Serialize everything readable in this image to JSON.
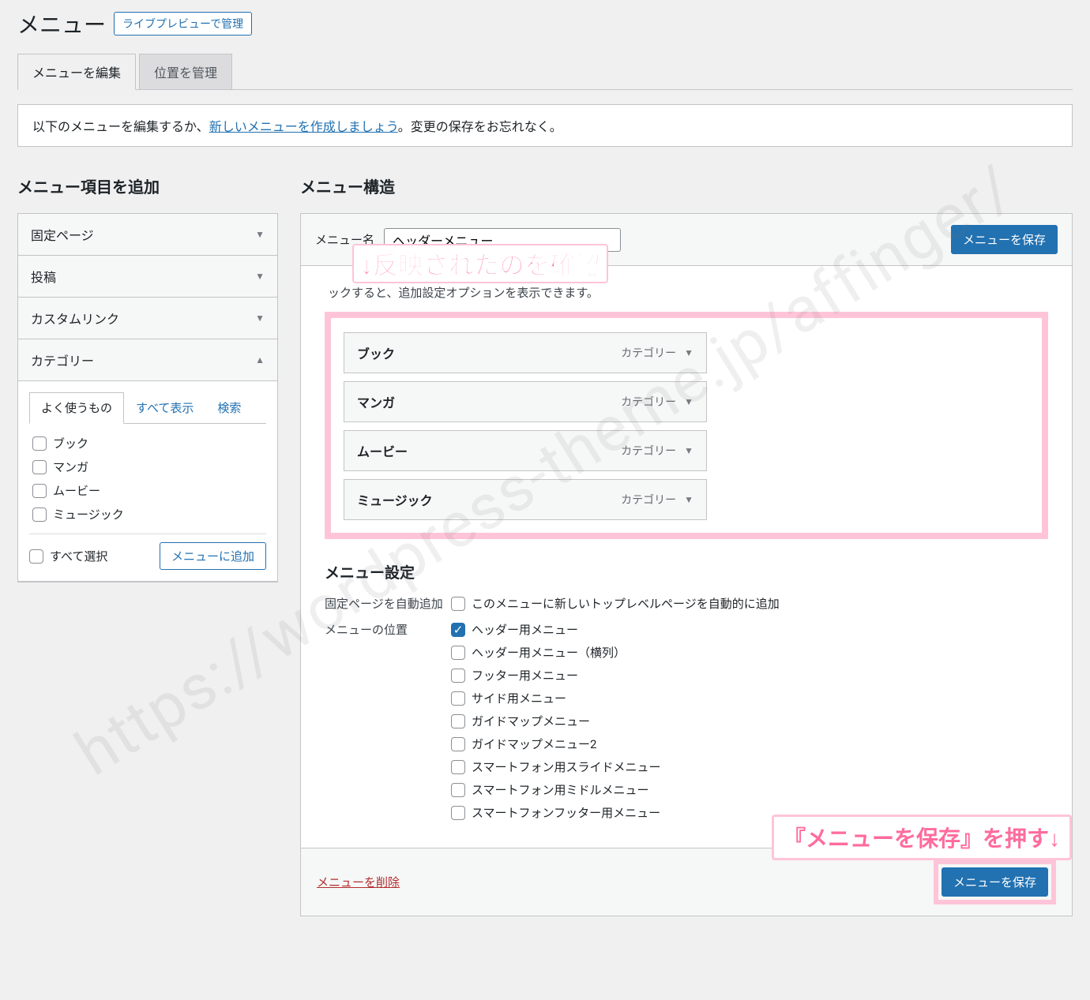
{
  "page": {
    "title": "メニュー",
    "livePreview": "ライブプレビューで管理"
  },
  "tabs": {
    "edit": "メニューを編集",
    "locations": "位置を管理"
  },
  "notice": {
    "prefix": "以下のメニューを編集するか、",
    "link": "新しいメニューを作成しましょう",
    "suffix": "。変更の保存をお忘れなく。"
  },
  "addItems": {
    "title": "メニュー項目を追加",
    "pages": "固定ページ",
    "posts": "投稿",
    "customLinks": "カスタムリンク",
    "categories": "カテゴリー",
    "subtabs": {
      "frequent": "よく使うもの",
      "all": "すべて表示",
      "search": "検索"
    },
    "items": [
      "ブック",
      "マンガ",
      "ムービー",
      "ミュージック"
    ],
    "selectAll": "すべて選択",
    "addToMenu": "メニューに追加"
  },
  "structure": {
    "title": "メニュー構造",
    "menuNameLabel": "メニュー名",
    "menuNameValue": "ヘッダーメニュー",
    "saveButton": "メニューを保存",
    "hint": "ックすると、追加設定オプションを表示できます。",
    "annotation1": "↓反映されたのを確認",
    "items": [
      {
        "title": "ブック",
        "type": "カテゴリー"
      },
      {
        "title": "マンガ",
        "type": "カテゴリー"
      },
      {
        "title": "ムービー",
        "type": "カテゴリー"
      },
      {
        "title": "ミュージック",
        "type": "カテゴリー"
      }
    ]
  },
  "settings": {
    "title": "メニュー設定",
    "autoAddLabel": "固定ページを自動追加",
    "autoAddText": "このメニューに新しいトップレベルページを自動的に追加",
    "locationLabel": "メニューの位置",
    "locations": [
      {
        "label": "ヘッダー用メニュー",
        "checked": true
      },
      {
        "label": "ヘッダー用メニュー（横列）",
        "checked": false
      },
      {
        "label": "フッター用メニュー",
        "checked": false
      },
      {
        "label": "サイド用メニュー",
        "checked": false
      },
      {
        "label": "ガイドマップメニュー",
        "checked": false
      },
      {
        "label": "ガイドマップメニュー2",
        "checked": false
      },
      {
        "label": "スマートフォン用スライドメニュー",
        "checked": false
      },
      {
        "label": "スマートフォン用ミドルメニュー",
        "checked": false
      },
      {
        "label": "スマートフォンフッター用メニュー",
        "checked": false
      }
    ]
  },
  "footer": {
    "delete": "メニューを削除",
    "annotation2": "『メニューを保存』を押す↓"
  },
  "watermark": "https://wordpress-theme.jp/affinger/"
}
